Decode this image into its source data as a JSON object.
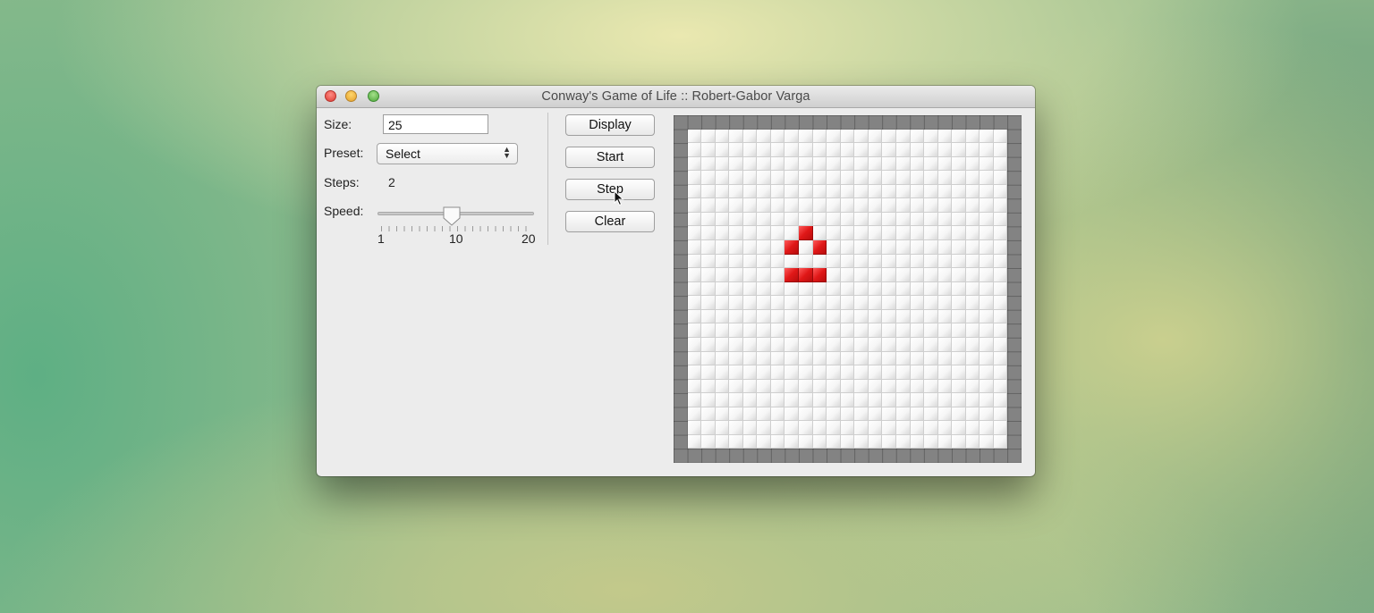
{
  "window": {
    "title": "Conway's Game of Life :: Robert-Gabor Varga"
  },
  "controls": {
    "size_label": "Size:",
    "size_value": "25",
    "preset_label": "Preset:",
    "preset_value": "Select",
    "steps_label": "Steps:",
    "steps_value": "2",
    "speed_label": "Speed:",
    "speed": {
      "min": 1,
      "max": 20,
      "value": 9,
      "tick_labels": [
        "1",
        "10",
        "20"
      ]
    }
  },
  "buttons": {
    "display": "Display",
    "start": "Start",
    "step": "Step",
    "clear": "Clear"
  },
  "board": {
    "size": 25,
    "alive_cells": [
      [
        8,
        9
      ],
      [
        9,
        8
      ],
      [
        9,
        10
      ],
      [
        11,
        8
      ],
      [
        11,
        9
      ],
      [
        11,
        10
      ]
    ],
    "alive_color": "#e01818",
    "border_color": "#838383"
  },
  "icons": [
    "close-icon",
    "minimize-icon",
    "zoom-icon",
    "select-arrows-icon",
    "slider-thumb-icon",
    "mouse-cursor-icon"
  ]
}
